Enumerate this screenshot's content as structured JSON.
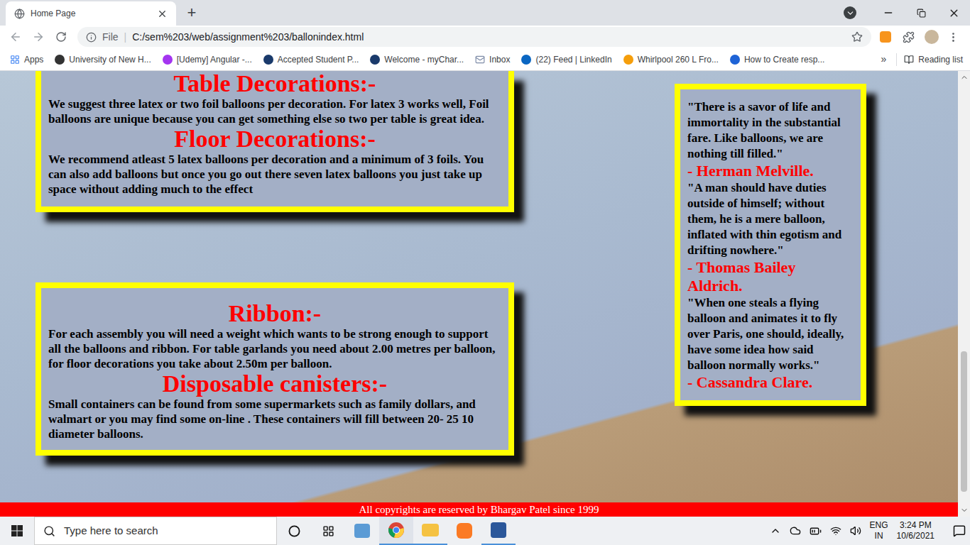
{
  "window": {
    "tabs": [
      {
        "title": "Home Page",
        "selected": true
      }
    ],
    "new_tab": "+"
  },
  "address_bar": {
    "scheme": "File",
    "separator": "|",
    "url": "C:/sem%203/web/assignment%203/ballonindex.html"
  },
  "bookmarks": [
    {
      "label": "Apps",
      "color": "#4285f4"
    },
    {
      "label": "University of New H...",
      "color": "#333333"
    },
    {
      "label": "[Udemy] Angular -...",
      "color": "#a435f0"
    },
    {
      "label": "Accepted Student P...",
      "color": "#1a3a6b"
    },
    {
      "label": "Welcome - myChar...",
      "color": "#1a3a6b"
    },
    {
      "label": "Inbox",
      "color": "#7c8aa6"
    },
    {
      "label": "(22) Feed | LinkedIn",
      "color": "#0a66c2"
    },
    {
      "label": "Whirlpool 260 L Fro...",
      "color": "#f59e0b"
    },
    {
      "label": "How to Create resp...",
      "color": "#1e63d6"
    }
  ],
  "bookmarks_overflow": "»",
  "reading_list": "Reading list",
  "page": {
    "cards": [
      {
        "sections": [
          {
            "heading": "Table Decorations:-",
            "text": "We suggest three latex or two foil balloons per decoration. For latex 3 works well, Foil balloons are unique because you can get something else so two per table is great idea."
          },
          {
            "heading": "Floor Decorations:-",
            "text": "We recommend atleast 5 latex balloons per decoration and a minimum of 3 foils. You can also add balloons but once you go out there seven latex balloons you just take up space without adding much to the effect"
          }
        ]
      },
      {
        "sections": [
          {
            "heading": "Ribbon:-",
            "text": "For each assembly you will need a weight which wants to be strong enough to support all the balloons and ribbon. For table garlands you need about 2.00 metres per balloon, for floor decorations you take about 2.50m per balloon."
          },
          {
            "heading": "Disposable canisters:-",
            "text": "Small containers can be found from some supermarkets such as family dollars, and walmart or you may find some on-line . These containers will fill between 20- 25 10 diameter balloons."
          }
        ]
      }
    ],
    "quotes": [
      {
        "text": "\"There is a savor of life and immortality in the substantial fare. Like balloons, we are nothing till filled.\"",
        "author": "- Herman Melville."
      },
      {
        "text": "\"A man should have duties outside of himself; without them, he is a mere balloon, inflated with thin egotism and drifting nowhere.\"",
        "author": "- Thomas Bailey Aldrich."
      },
      {
        "text": "\"When one steals a flying balloon and animates it to fly over Paris, one should, ideally, have some idea how said balloon normally works.\"",
        "author": "- Cassandra Clare."
      }
    ],
    "footer": "All copyrights are reserved by Bhargav Patel since 1999"
  },
  "taskbar": {
    "search_placeholder": "Type here to search",
    "language": "ENG",
    "region": "IN",
    "time": "3:24 PM",
    "date": "10/6/2021"
  }
}
